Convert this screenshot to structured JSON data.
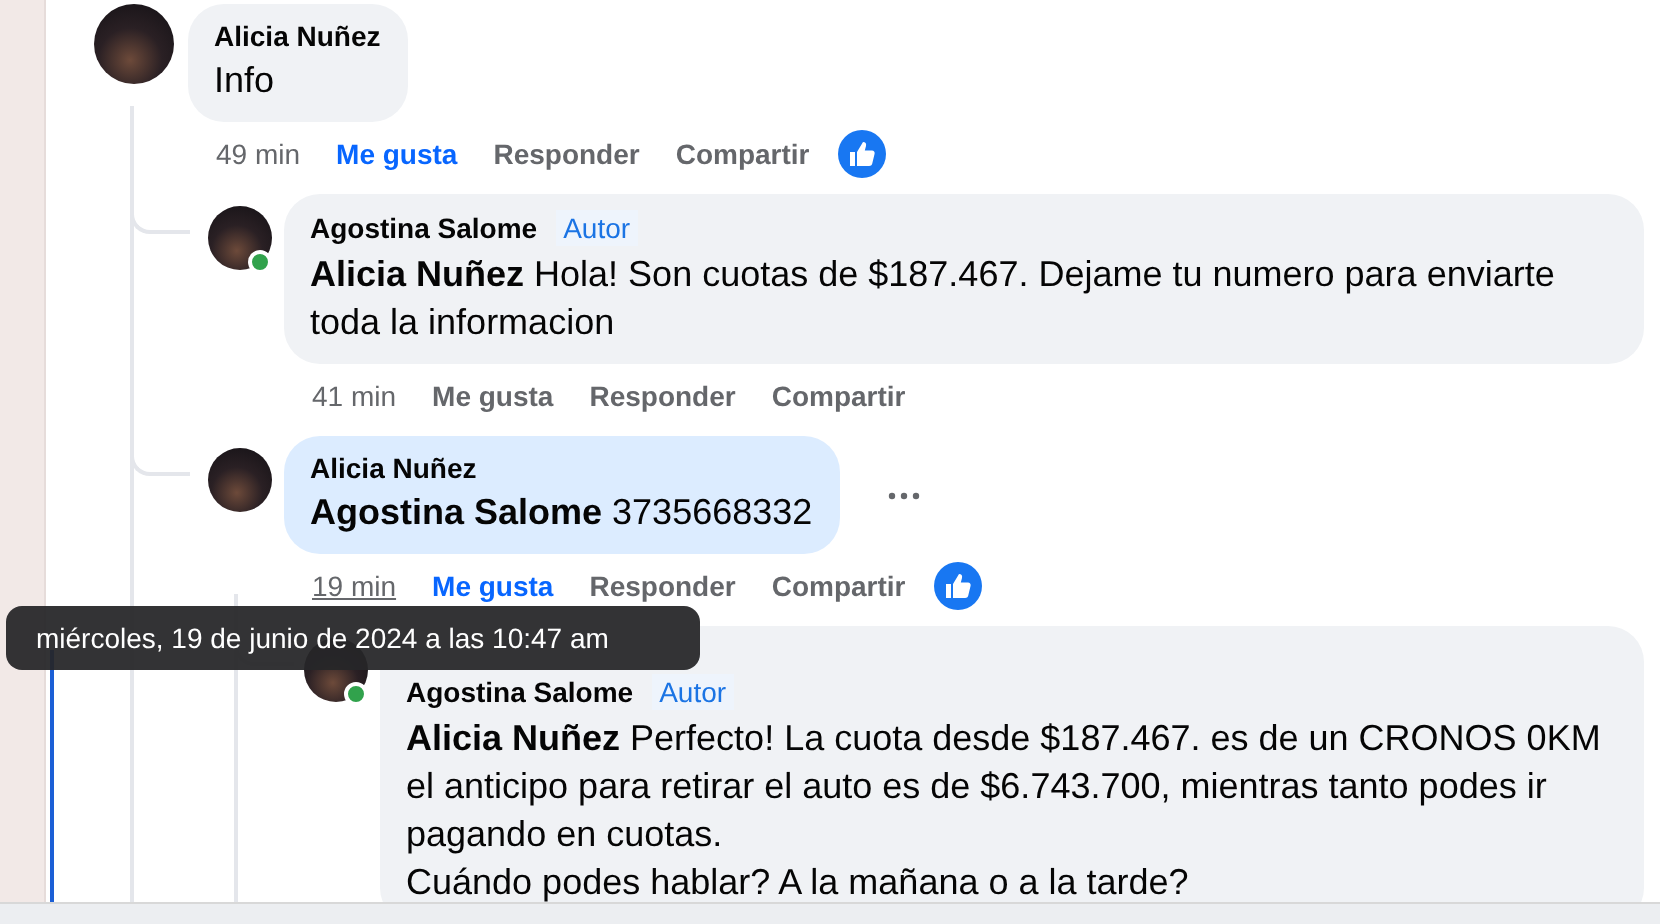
{
  "comments": [
    {
      "author": "Alicia Nuñez",
      "text": "Info",
      "time": "49 min",
      "like_label": "Me gusta",
      "liked": true,
      "reply_label": "Responder",
      "share_label": "Compartir",
      "reaction": true,
      "online": false,
      "highlighted": false,
      "time_hovered": false,
      "more_button": false,
      "children": [
        {
          "author": "Agostina Salome",
          "author_badge": "Autor",
          "text": "**Alicia Nuñez** Hola! Son cuotas de $187.467. Dejame tu numero para enviarte toda la informacion",
          "time": "41 min",
          "like_label": "Me gusta",
          "liked": false,
          "reply_label": "Responder",
          "share_label": "Compartir",
          "reaction": false,
          "online": true,
          "highlighted": false,
          "time_hovered": false,
          "more_button": false
        },
        {
          "author": "Alicia Nuñez",
          "text": "**Agostina Salome** 3735668332",
          "time": "19 min",
          "like_label": "Me gusta",
          "liked": true,
          "reply_label": "Responder",
          "share_label": "Compartir",
          "reaction": true,
          "online": false,
          "highlighted": true,
          "time_hovered": true,
          "more_button": true,
          "children": [
            {
              "author": "Agostina Salome",
              "author_badge": "Autor",
              "text": "**Alicia Nuñez** Perfecto! La cuota desde $187.467. es de un CRONOS 0KM el anticipo para retirar el auto es de $6.743.700, mientras tanto podes ir pagando en cuotas.\nCuándo podes hablar? A la mañana o a la tarde?",
              "online": true,
              "highlighted": false,
              "more_button": false
            }
          ]
        }
      ]
    }
  ],
  "tooltip": {
    "text": "miércoles, 19 de junio de 2024 a las 10:47 am"
  }
}
